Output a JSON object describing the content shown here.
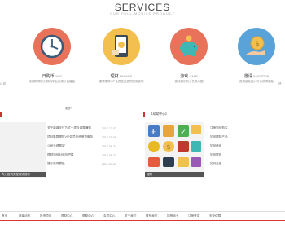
{
  "header": {
    "title": "SERVICES",
    "subtitle": "OUR FULL-MOBILE PRODUCT"
  },
  "services": [
    {
      "name": "日购币",
      "en": "YWC",
      "desc": "到期购物积分换购平台实现价值增值",
      "color": "#e8735a",
      "icon": "clock-icon"
    },
    {
      "name": "理财",
      "en": "FINANCE",
      "desc": "稳健理财VIP会员投资借贷服务说明",
      "color": "#f3c04f",
      "icon": "phone-money-icon"
    },
    {
      "name": "游戏",
      "en": "GAME",
      "desc": "游戏娱乐积分兑换乐园",
      "color": "#e8735a",
      "icon": "piggy-bank-icon"
    },
    {
      "name": "邀请",
      "en": "INVITATION",
      "desc": "邀请朋友加入可以获得奖励",
      "color": "#5aa3d9",
      "icon": "coin-hand-icon"
    }
  ],
  "edge_left_text": "以说",
  "edge_right_text": "送",
  "left_more": "更多+",
  "left_news": [
    {
      "title": "关于新增支付方式一项目调整通知",
      "date": "2017-12-03"
    },
    {
      "title": "项目集群理财VIP会员投资借贷服务",
      "date": "2017-11-08"
    },
    {
      "title": "公司业绩展望",
      "date": "2017-09-24"
    },
    {
      "title": "理财如何对风险把握",
      "date": "2017-09-21"
    },
    {
      "title": "提示新闻模板",
      "date": "2017-09-06"
    }
  ],
  "left_caption": "大力投资类型服务提示",
  "right_header": "【帮助中心】",
  "right_caption": "理财",
  "right_links": [
    {
      "title": "注册如何购买"
    },
    {
      "title": "如何理财产品"
    },
    {
      "title": "如何使用"
    },
    {
      "title": "如何提现"
    },
    {
      "title": "如何充值"
    }
  ],
  "nav": [
    "首页",
    "新闻动态",
    "投资项目",
    "理财中心",
    "帮助中心",
    "会员中心",
    "关于我们",
    "联系我们",
    "招贤纳士",
    "注册登录",
    "安全保障"
  ],
  "colors": {
    "accent": "#d33333"
  }
}
